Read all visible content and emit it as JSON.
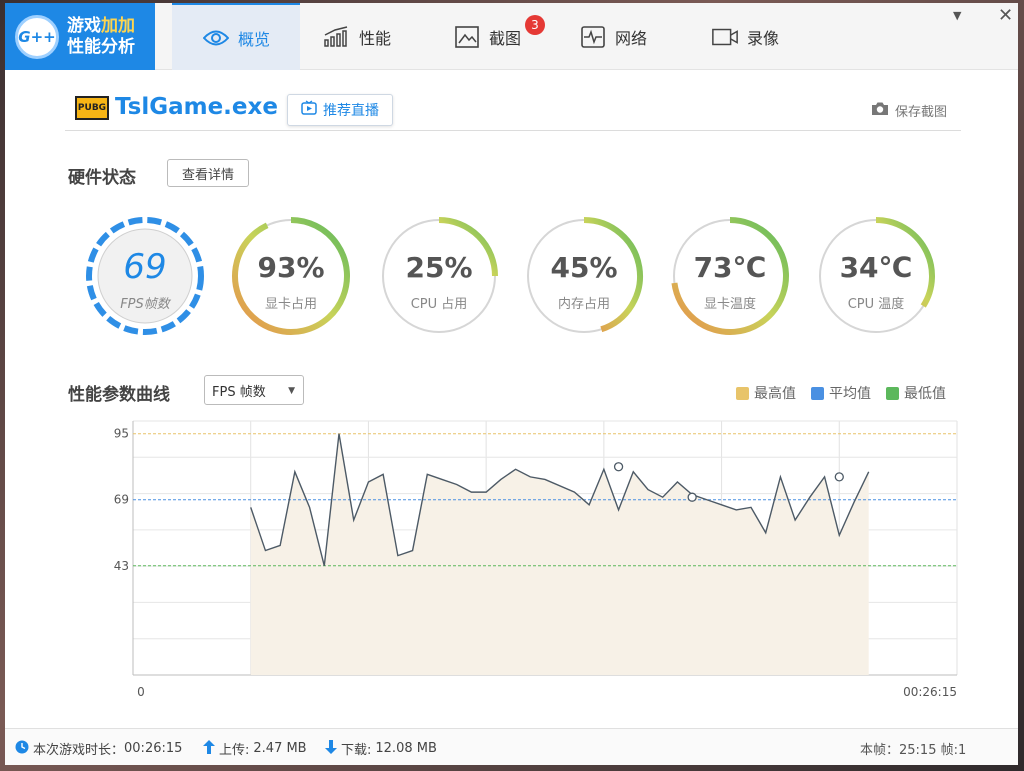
{
  "app": {
    "logo_badge": "G++",
    "logo_line1_a": "游戏",
    "logo_line1_b": "加加",
    "logo_line2": "性能分析"
  },
  "tabs": [
    {
      "label": "概览",
      "icon": "eye-icon",
      "active": true
    },
    {
      "label": "性能",
      "icon": "bar-chart-icon",
      "active": false
    },
    {
      "label": "截图",
      "icon": "image-icon",
      "active": false,
      "badge": "3"
    },
    {
      "label": "网络",
      "icon": "pulse-icon",
      "active": false
    },
    {
      "label": "录像",
      "icon": "video-camera-icon",
      "active": false
    }
  ],
  "game": {
    "logo_text": "PUBG",
    "name": "TslGame.exe",
    "live_button": "推荐直播",
    "save_screenshot": "保存截图"
  },
  "hardware": {
    "title": "硬件状态",
    "detail_button": "查看详情",
    "gauges": [
      {
        "value": "69",
        "label": "FPS帧数",
        "percent": 100
      },
      {
        "value": "93%",
        "label": "显卡占用",
        "percent": 93
      },
      {
        "value": "25%",
        "label": "CPU 占用",
        "percent": 25
      },
      {
        "value": "45%",
        "label": "内存占用",
        "percent": 45
      },
      {
        "value": "73℃",
        "label": "显卡温度",
        "percent": 73
      },
      {
        "value": "34℃",
        "label": "CPU 温度",
        "percent": 34
      }
    ]
  },
  "curve": {
    "title": "性能参数曲线",
    "selected_metric": "FPS 帧数",
    "legend": [
      {
        "label": "最高值",
        "color": "#e8c46a"
      },
      {
        "label": "平均值",
        "color": "#4a90e2"
      },
      {
        "label": "最低值",
        "color": "#5cb85c"
      }
    ]
  },
  "chart_data": {
    "type": "line",
    "ylim": [
      0,
      100
    ],
    "y_ticks": [
      95,
      69,
      43
    ],
    "reference_lines": {
      "max": 95,
      "avg": 69,
      "min": 43
    },
    "x_start_label": "0",
    "x_end_label": "00:26:15",
    "x_range": [
      0,
      28
    ],
    "x": [
      4,
      4.5,
      5,
      5.5,
      6,
      6.5,
      7,
      7.5,
      8,
      8.5,
      9,
      9.5,
      10,
      10.5,
      11,
      11.5,
      12,
      12.5,
      13,
      13.5,
      14,
      15,
      15.5,
      16,
      16.5,
      17,
      17.5,
      18,
      18.5,
      19,
      19.5,
      20,
      20.5,
      21,
      21.5,
      22,
      22.5,
      23,
      23.5,
      24,
      24.5,
      25,
      25.5,
      26,
      26.5,
      27
    ],
    "y": [
      66,
      49,
      51,
      80,
      66,
      43,
      95,
      61,
      76,
      79,
      47,
      49,
      79,
      77,
      75,
      72,
      72,
      77,
      81,
      78,
      77,
      72,
      67,
      81,
      65,
      80,
      73,
      70,
      76,
      71,
      69,
      67,
      65,
      66,
      56,
      78,
      61,
      70,
      78,
      55,
      68,
      80
    ],
    "markers": [
      {
        "x": 16.5,
        "y": 82
      },
      {
        "x": 19,
        "y": 70
      },
      {
        "x": 24,
        "y": 78
      }
    ]
  },
  "status": {
    "play_time_label": "本次游戏时长：",
    "play_time": "00:26:15",
    "upload_label": "上传:",
    "upload": "2.47 MB",
    "download_label": "下载:",
    "download": "12.08 MB",
    "right_text": "本帧：25:15 帧:1"
  }
}
